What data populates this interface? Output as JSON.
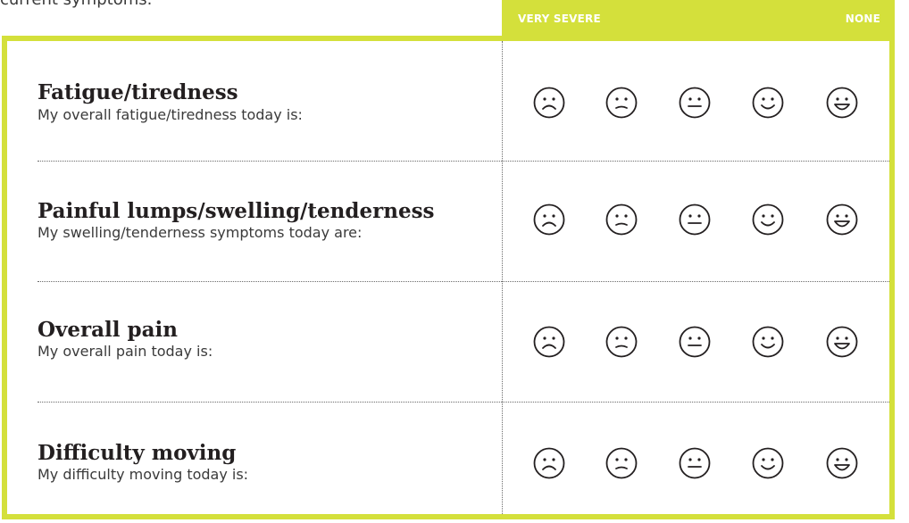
{
  "intro_text": "current symptoms.",
  "scale": {
    "left_label": "VERY SEVERE",
    "right_label": "NONE"
  },
  "colors": {
    "accent": "#d4e03b",
    "text": "#231f20",
    "divider": "#6b6b6b"
  },
  "face_icons": [
    "very-sad-face-icon",
    "sad-face-icon",
    "neutral-face-icon",
    "smile-face-icon",
    "grin-face-icon"
  ],
  "questions": [
    {
      "title": "Fatigue/tiredness",
      "subtitle": "My overall fatigue/tiredness today is:"
    },
    {
      "title": "Painful lumps/swelling/tenderness",
      "subtitle": "My swelling/tenderness symptoms today are:"
    },
    {
      "title": "Overall pain",
      "subtitle": "My overall pain today is:"
    },
    {
      "title": "Difficulty moving",
      "subtitle": "My difficulty moving today is:"
    }
  ]
}
